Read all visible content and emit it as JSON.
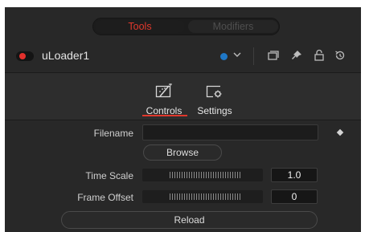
{
  "segment": {
    "tools_label": "Tools",
    "modifiers_label": "Modifiers",
    "active": "Tools"
  },
  "tool": {
    "name": "uLoader1",
    "power_on": true,
    "color": "#1f78c7"
  },
  "header_icons": [
    "color-swatch-icon",
    "chevron-down-icon",
    "versions-icon",
    "pin-icon",
    "lock-icon",
    "reset-icon"
  ],
  "tabs": [
    {
      "label": "Controls",
      "icon": "controls-icon",
      "active": true
    },
    {
      "label": "Settings",
      "icon": "settings-icon",
      "active": false
    }
  ],
  "controls": {
    "filename": {
      "label": "Filename",
      "value": ""
    },
    "browse_label": "Browse",
    "time_scale": {
      "label": "Time Scale",
      "value": "1.0"
    },
    "frame_offset": {
      "label": "Frame Offset",
      "value": "0"
    },
    "reload_label": "Reload"
  },
  "colors": {
    "accent": "#e0382c",
    "panel": "#282828",
    "tool_color": "#1f78c7"
  }
}
